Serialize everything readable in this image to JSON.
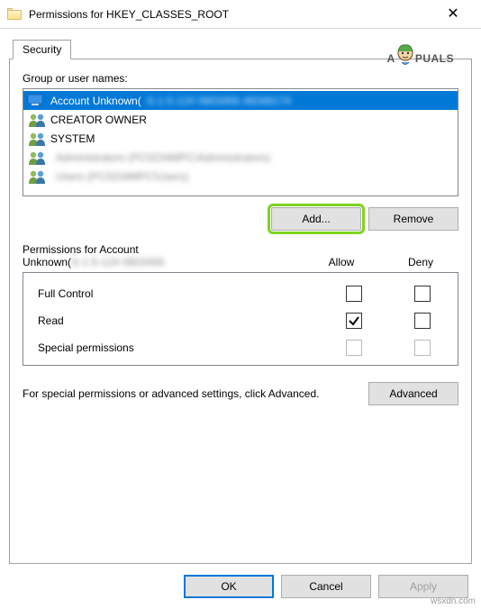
{
  "titlebar": {
    "title": "Permissions for HKEY_CLASSES_ROOT"
  },
  "tab": {
    "security": "Security"
  },
  "watermark": {
    "text_prefix": "A",
    "text_suffix": "PUALS"
  },
  "labels": {
    "group": "Group or user names:",
    "allow": "Allow",
    "deny": "Deny",
    "advanced_text": "For special permissions or advanced settings, click Advanced."
  },
  "users": {
    "items": [
      {
        "name": "Account Unknown(",
        "obscured": "S-1-5-124  0803456  48348174",
        "icon": "single",
        "selected": true
      },
      {
        "name": "CREATOR OWNER",
        "obscured": "",
        "icon": "group",
        "selected": false
      },
      {
        "name": "SYSTEM",
        "obscured": "",
        "icon": "group",
        "selected": false
      },
      {
        "name": "",
        "obscured": "Administrators (PC0234MPC\\Administrators)",
        "icon": "group",
        "selected": false
      },
      {
        "name": "",
        "obscured": "Users (PC0234MPC\\Users)",
        "icon": "group",
        "selected": false
      }
    ]
  },
  "perm_heading": {
    "line1": "Permissions for Account",
    "line2_prefix": "Unknown(",
    "line2_obscured": "S-1-5-124 0803456"
  },
  "permissions": {
    "rows": [
      {
        "label": "Full Control",
        "allow": false,
        "deny": false,
        "disabled": false
      },
      {
        "label": "Read",
        "allow": true,
        "deny": false,
        "disabled": false
      },
      {
        "label": "Special permissions",
        "allow": false,
        "deny": false,
        "disabled": true
      }
    ]
  },
  "buttons": {
    "add": "Add...",
    "remove": "Remove",
    "advanced": "Advanced",
    "ok": "OK",
    "cancel": "Cancel",
    "apply": "Apply"
  },
  "attribution": "wsxdn.com"
}
